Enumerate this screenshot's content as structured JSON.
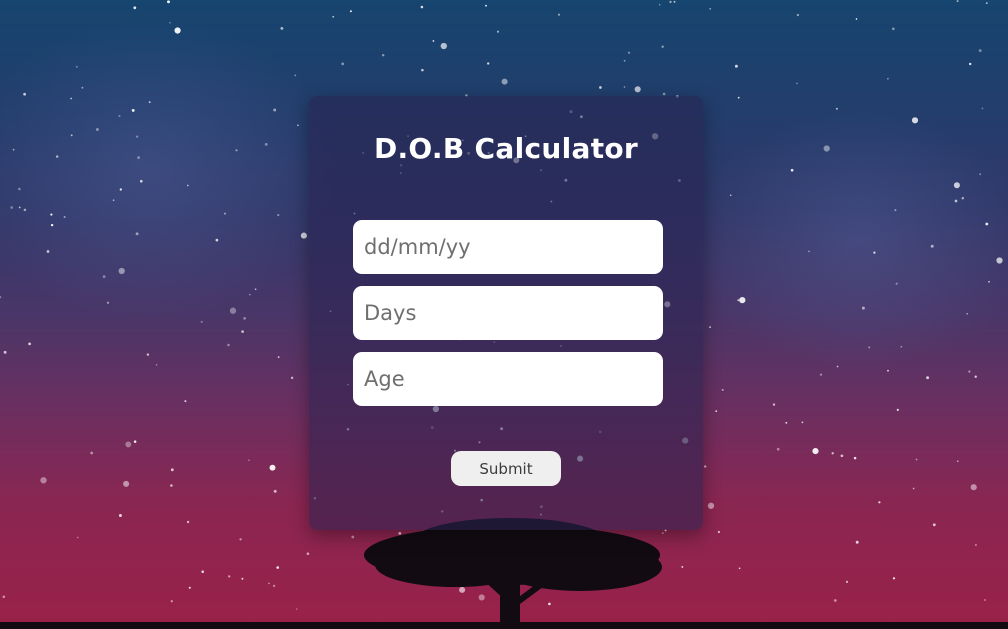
{
  "app": {
    "title": "D.O.B Calculator"
  },
  "form": {
    "dob_placeholder": "dd/mm/yy",
    "dob_value": "",
    "days_placeholder": "Days",
    "days_value": "",
    "age_placeholder": "Age",
    "age_value": "",
    "submit_label": "Submit"
  },
  "colors": {
    "sky_top": "#16456f",
    "sky_mid": "#4a3668",
    "sky_bottom": "#9a2148",
    "card_bg": "rgba(40,34,80,0.55)",
    "input_bg": "#ffffff",
    "button_bg": "#efefef",
    "title_color": "#ffffff"
  },
  "background": {
    "icon": "starry-night-tree"
  }
}
